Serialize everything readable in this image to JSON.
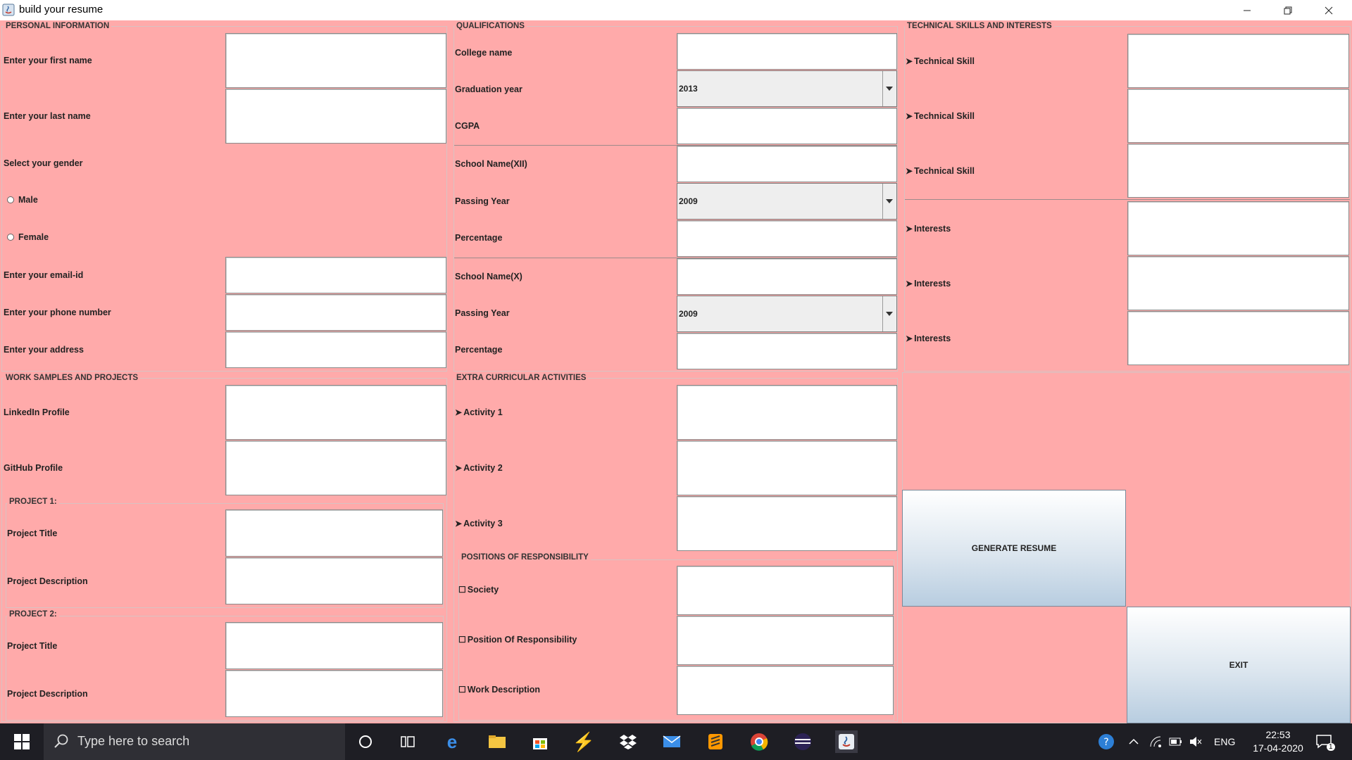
{
  "window": {
    "title": "build your resume"
  },
  "personal": {
    "title": "PERSONAL INFORMATION",
    "first_name": "Enter your first name",
    "last_name": "Enter your last name",
    "gender": "Select your gender",
    "male": "Male",
    "female": "Female",
    "email": "Enter your email-id",
    "phone": "Enter your phone number",
    "address": "Enter your address"
  },
  "qualifications": {
    "title": "QUALIFICATIONS",
    "college": "College name",
    "grad_year": "Graduation year",
    "grad_year_value": "2013",
    "cgpa": "CGPA",
    "school12": "School Name(XII)",
    "pass12": "Passing Year",
    "pass12_value": "2009",
    "perc12": "Percentage",
    "school10": "School Name(X)",
    "pass10": "Passing Year",
    "pass10_value": "2009",
    "perc10": "Percentage"
  },
  "skills": {
    "title": "TECHNICAL SKILLS AND INTERESTS",
    "skill_label": "Technical Skill",
    "interest_label": "Interests"
  },
  "work": {
    "title": "WORK SAMPLES AND PROJECTS",
    "linkedin": "LinkedIn Profile",
    "github": "GitHub Profile",
    "project1": "PROJECT 1:",
    "project2": "PROJECT 2:",
    "project_title": "Project Title",
    "project_desc": "Project Description"
  },
  "extra": {
    "title": "EXTRA CURRICULAR ACTIVITIES",
    "activity1": "Activity 1",
    "activity2": "Activity 2",
    "activity3": "Activity 3",
    "por_title": "POSITIONS OF RESPONSIBILITY",
    "society": "Society",
    "position": "Position Of Responsibility",
    "work_desc": "Work Description"
  },
  "buttons": {
    "generate": "GENERATE RESUME",
    "exit": "EXIT"
  },
  "taskbar": {
    "search_placeholder": "Type here to search",
    "lang": "ENG",
    "time": "22:53",
    "date": "17-04-2020",
    "notifications": "1"
  },
  "colors": {
    "panel_bg": "#ffaaaa",
    "taskbar_bg": "#1e1e24"
  }
}
